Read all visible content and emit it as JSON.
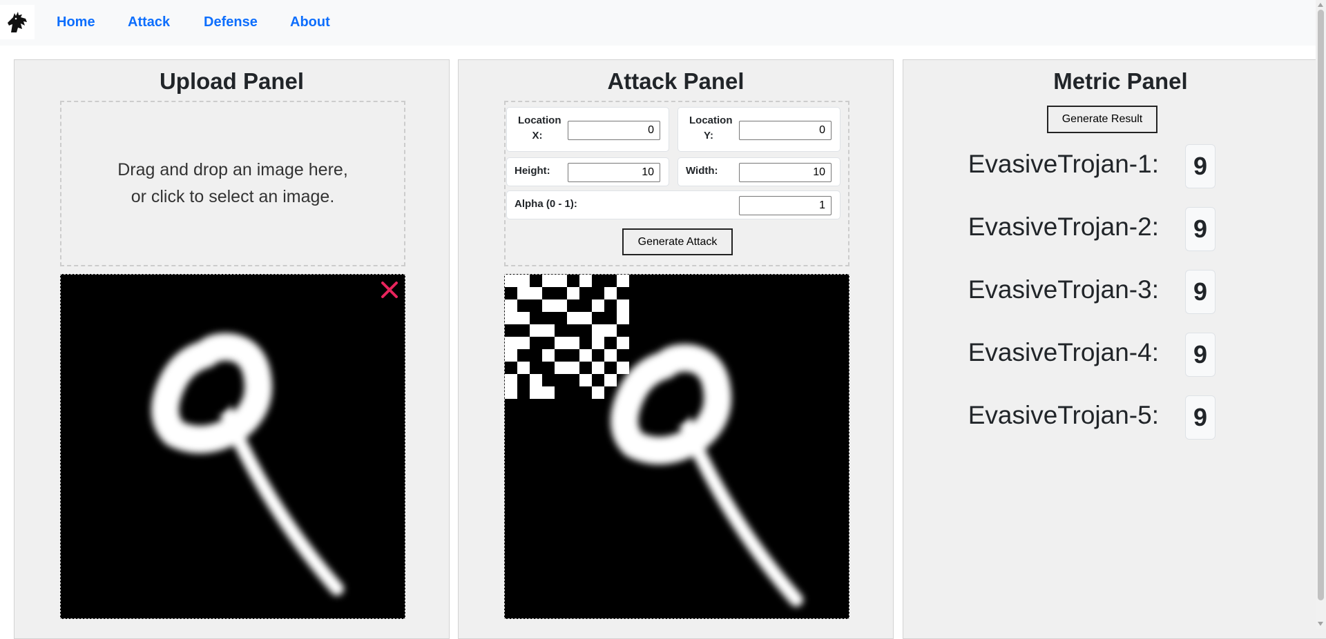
{
  "nav": {
    "links": [
      "Home",
      "Attack",
      "Defense",
      "About"
    ]
  },
  "upload_panel": {
    "title": "Upload Panel",
    "dropzone_line1": "Drag and drop an image here,",
    "dropzone_line2": "or click to select an image."
  },
  "attack_panel": {
    "title": "Attack Panel",
    "location_x_label_1": "Location",
    "location_x_label_2": "X:",
    "location_x_value": "0",
    "location_y_label_1": "Location",
    "location_y_label_2": "Y:",
    "location_y_value": "0",
    "height_label": "Height:",
    "height_value": "10",
    "width_label": "Width:",
    "width_value": "10",
    "alpha_label": "Alpha (0 - 1):",
    "alpha_value": "1",
    "generate_label": "Generate Attack"
  },
  "metric_panel": {
    "title": "Metric Panel",
    "generate_label": "Generate Result",
    "results": [
      {
        "label": "EvasiveTrojan-1:",
        "value": "9"
      },
      {
        "label": "EvasiveTrojan-2:",
        "value": "9"
      },
      {
        "label": "EvasiveTrojan-3:",
        "value": "9"
      },
      {
        "label": "EvasiveTrojan-4:",
        "value": "9"
      },
      {
        "label": "EvasiveTrojan-5:",
        "value": "9"
      }
    ]
  },
  "colors": {
    "nav_link": "#0d6efd",
    "close_x": "#e8245c",
    "panel_bg": "#f0f0f0"
  },
  "icons": {
    "logo": "horse-head-icon",
    "remove": "close-icon"
  }
}
